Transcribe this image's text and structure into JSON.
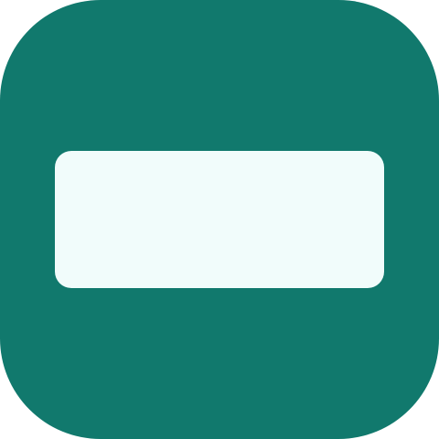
{
  "icon": {
    "name": "minus-icon",
    "background_color": "#11796d",
    "glyph_color": "#f1fcfb"
  }
}
